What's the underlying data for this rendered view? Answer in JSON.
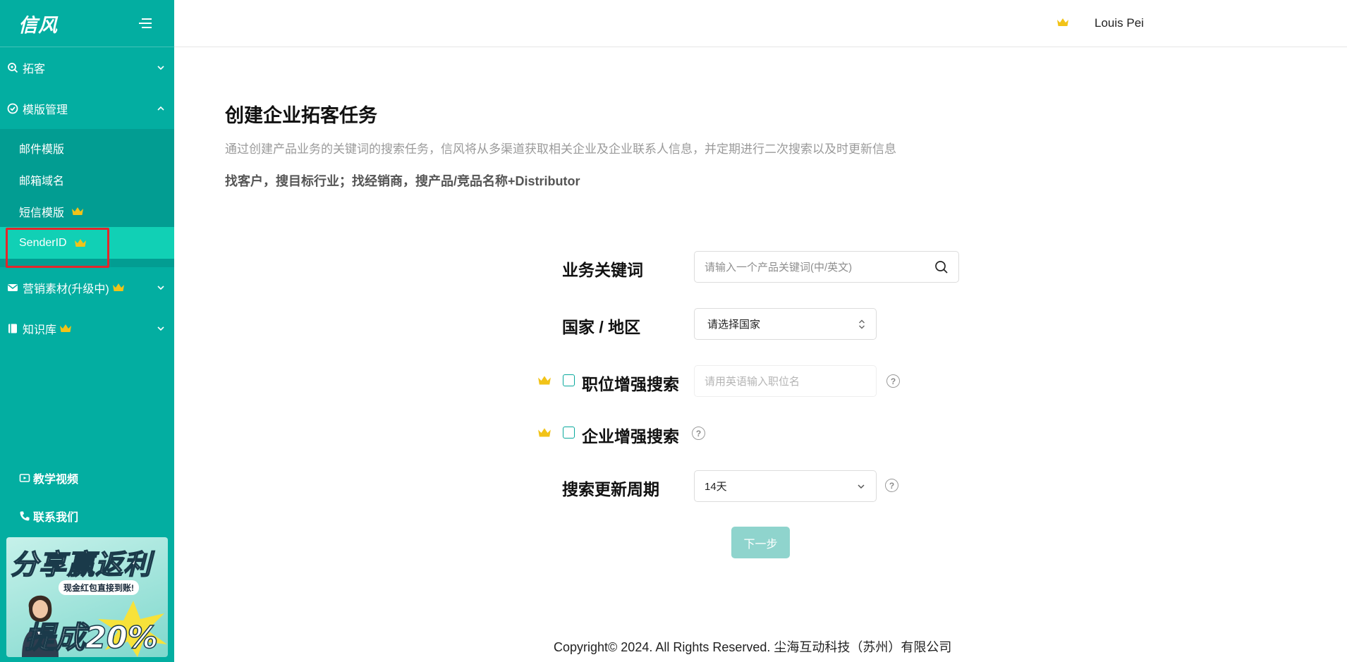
{
  "sidebar": {
    "logo": "信风",
    "menu": [
      {
        "label": "拓客",
        "icon": "search-target-icon",
        "expanded": false
      },
      {
        "label": "模版管理",
        "icon": "check-circle-icon",
        "expanded": true
      }
    ],
    "submenu": [
      {
        "label": "邮件模版",
        "premium": false
      },
      {
        "label": "邮箱域名",
        "premium": false
      },
      {
        "label": "短信模版",
        "premium": true
      },
      {
        "label": "SenderID",
        "premium": true,
        "active": true
      }
    ],
    "menu_after": [
      {
        "label": "营销素材(升级中)",
        "icon": "mail-icon",
        "premium": true
      },
      {
        "label": "知识库",
        "icon": "book-icon",
        "premium": true
      }
    ],
    "bottom_links": [
      {
        "label": "教学视频",
        "icon": "video-icon"
      },
      {
        "label": "联系我们",
        "icon": "phone-icon"
      }
    ],
    "promo": {
      "title": "分享赢返利",
      "subtitle": "现金红包直接到账!",
      "percent": "提成20%"
    }
  },
  "header": {
    "user_name": "Louis Pei"
  },
  "main": {
    "title": "创建企业拓客任务",
    "description": "通过创建产品业务的关键词的搜索任务，信风将从多渠道获取相关企业及企业联系人信息，并定期进行二次搜索以及时更新信息",
    "tip": "找客户，搜目标行业；找经销商，搜产品/竞品名称+Distributor"
  },
  "form": {
    "keyword_label": "业务关键词",
    "keyword_placeholder": "请输入一个产品关键词(中/英文)",
    "country_label": "国家 / 地区",
    "country_value": "请选择国家",
    "position_label": "职位增强搜索",
    "position_placeholder": "请用英语输入职位名",
    "company_label": "企业增强搜索",
    "cycle_label": "搜索更新周期",
    "cycle_value": "14天",
    "next_button": "下一步"
  },
  "footer": {
    "copyright": "Copyright© 2024. All Rights Reserved. 尘海互动科技（苏州）有限公司"
  },
  "colors": {
    "sidebar_bg": "#03aea1",
    "submenu_bg": "#029d92",
    "active_item_bg": "#11d0b5",
    "highlight_border": "#e3262b",
    "crown_gold": "#f2c318",
    "button_disabled": "#8fd4cd"
  }
}
